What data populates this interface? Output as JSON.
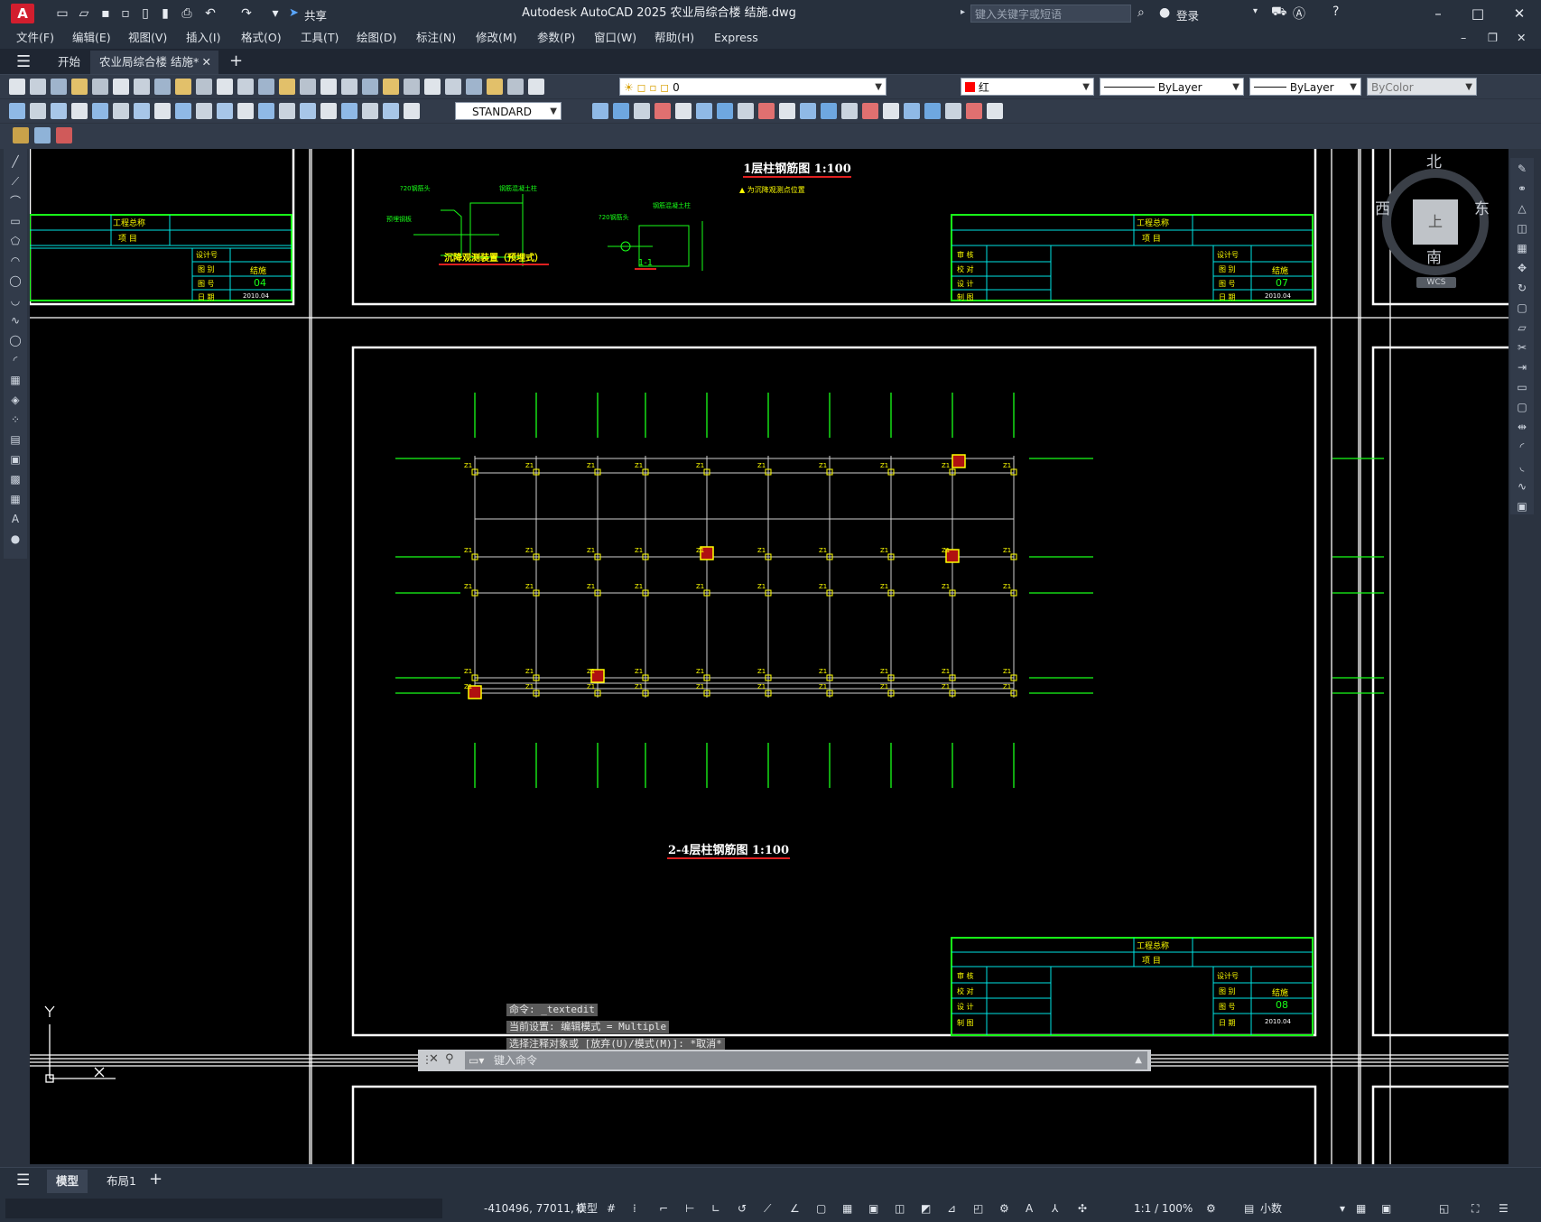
{
  "app": {
    "title": "Autodesk AutoCAD 2025    农业局综合楼  结施.dwg",
    "logo": "A",
    "search_placeholder": "键入关键字或短语",
    "login": "登录",
    "share": "共享"
  },
  "menu": [
    "文件(F)",
    "编辑(E)",
    "视图(V)",
    "插入(I)",
    "格式(O)",
    "工具(T)",
    "绘图(D)",
    "标注(N)",
    "修改(M)",
    "参数(P)",
    "窗口(W)",
    "帮助(H)",
    "Express"
  ],
  "tabs": {
    "start": "开始",
    "file": "农业局综合楼  结施*"
  },
  "toolbar": {
    "layer": "0",
    "color": "红",
    "linetype": "ByLayer",
    "lineweight": "ByLayer",
    "plotstyle": "ByColor",
    "textstyle": "STANDARD"
  },
  "viewcube": {
    "north": "北",
    "south": "南",
    "east": "东",
    "west": "西",
    "top": "上",
    "wcs": "WCS"
  },
  "drawing": {
    "title_1f": "1层柱钢筋图  1:100",
    "note_1f": "▲ 为沉降观测点位置",
    "title_24f": "2-4层柱钢筋图  1:100",
    "detail_title": "沉降观测装置（预埋式）",
    "section_title": "1-1",
    "tb_project": "工程总称",
    "tb_item": "项  目",
    "tb_designno": "设计号",
    "tb_category": "图  别",
    "tb_category_val": "结施",
    "tb_drawno": "图  号",
    "tb_date": "日  期",
    "tb_date_val": "2010.04",
    "tb_review": "审  核",
    "tb_check": "校  对",
    "tb_design": "设  计",
    "tb_draw": "制  图",
    "drawno_left": "04",
    "drawno_top": "07",
    "drawno_main": "08"
  },
  "command": {
    "line1": "命令: _textedit",
    "line2": "当前设置: 编辑模式 = Multiple",
    "line3": "选择注释对象或 [放弃(U)/模式(M)]: *取消*",
    "placeholder": "键入命令"
  },
  "layouts": {
    "model": "模型",
    "layout1": "布局1"
  },
  "status": {
    "coords": "-410496, 77011, 0",
    "model": "模型",
    "scale": "1:1 / 100%",
    "units": "小数"
  }
}
